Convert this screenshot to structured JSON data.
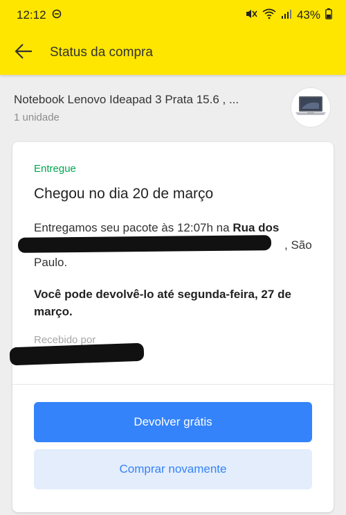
{
  "status_bar": {
    "time": "12:12",
    "battery": "43%"
  },
  "app_bar": {
    "title": "Status da compra"
  },
  "product": {
    "name": "Notebook Lenovo Ideapad 3 Prata 15.6 , ...",
    "quantity": "1 unidade"
  },
  "delivery": {
    "status": "Entregue",
    "headline": "Chegou no dia 20 de março",
    "detail_prefix": "Entregamos seu pacote às 12:07h na ",
    "detail_street": "Rua dos",
    "detail_suffix": ", São Paulo.",
    "return_info": "Você pode devolvê-lo até segunda-feira, 27 de março.",
    "received_by": "Recebido por"
  },
  "actions": {
    "return_label": "Devolver grátis",
    "buy_again_label": "Comprar novamente"
  },
  "colors": {
    "brand_yellow": "#ffe600",
    "success_green": "#00a650",
    "primary_blue": "#3483fa"
  }
}
